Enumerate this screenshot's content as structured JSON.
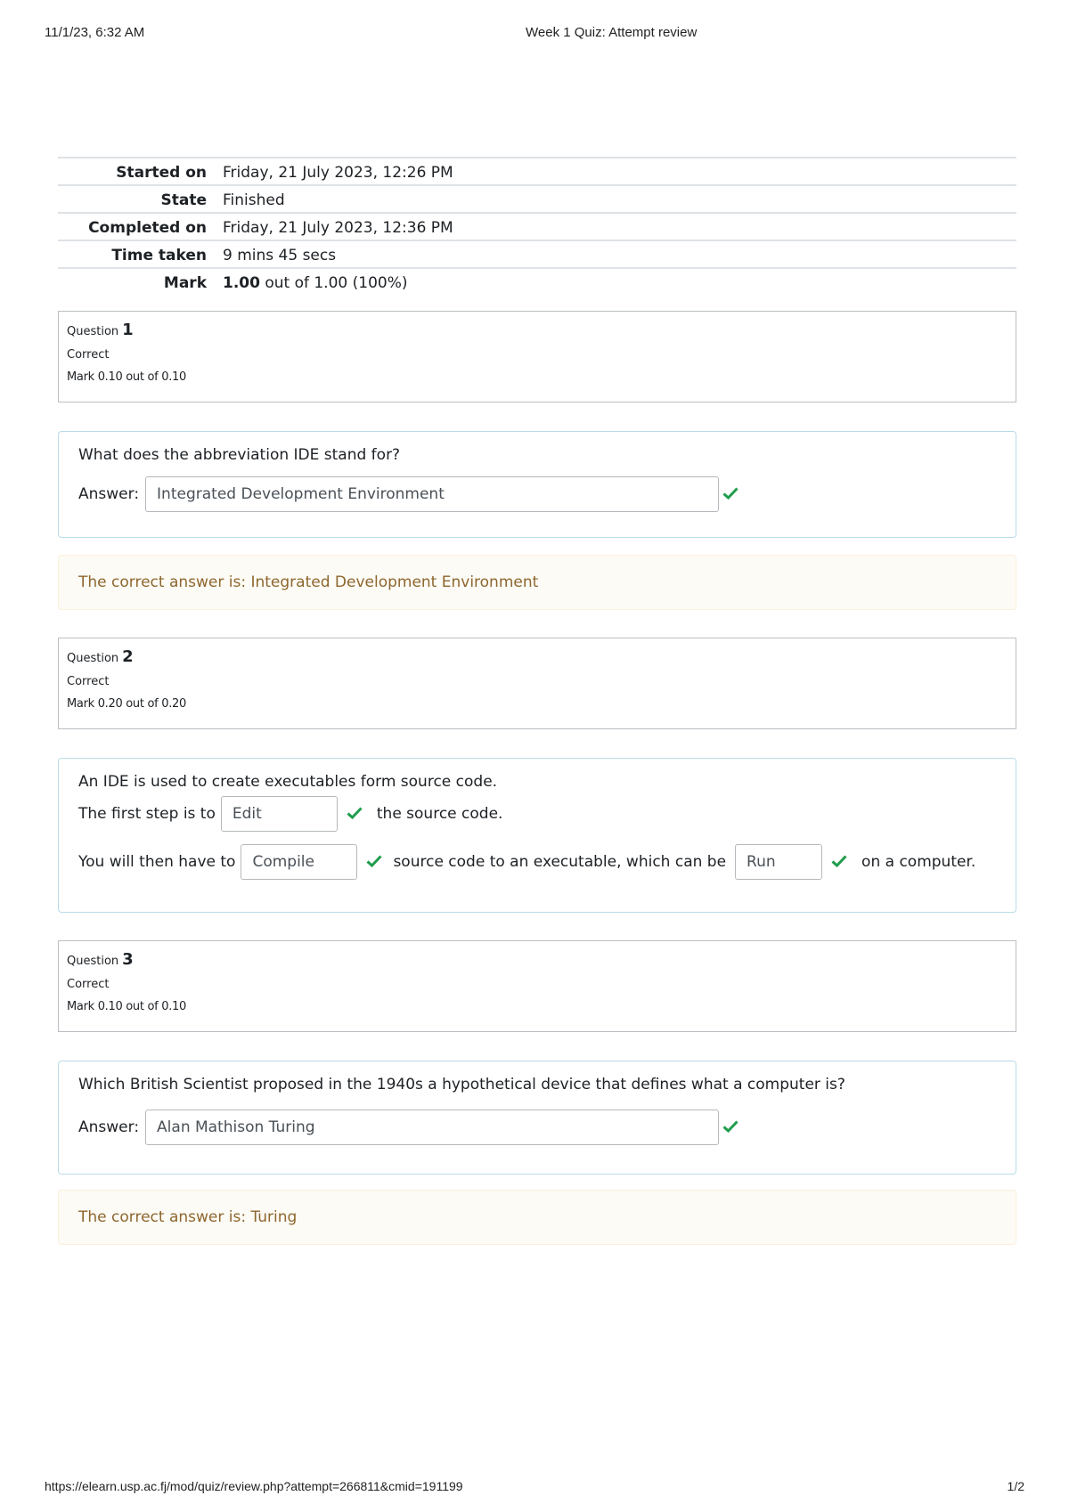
{
  "print_header": {
    "datetime": "11/1/23, 6:32 AM",
    "title": "Week 1 Quiz: Attempt review"
  },
  "summary": [
    {
      "label": "Started on",
      "value": "Friday, 21 July 2023, 12:26 PM"
    },
    {
      "label": "State",
      "value": "Finished"
    },
    {
      "label": "Completed on",
      "value": "Friday, 21 July 2023, 12:36 PM"
    },
    {
      "label": "Time taken",
      "value": "9 mins 45 secs"
    },
    {
      "label": "Mark",
      "value_bold": "1.00",
      "value_rest": " out of 1.00 (100%)"
    }
  ],
  "questions": [
    {
      "label": "Question",
      "number": "1",
      "state": "Correct",
      "grade": "Mark 0.10 out of 0.10",
      "text": "What does the abbreviation IDE stand for?",
      "answer_label": "Answer:",
      "answer_value": "Integrated Development Environment",
      "feedback": "The correct answer is: Integrated Development Environment"
    },
    {
      "label": "Question",
      "number": "2",
      "state": "Correct",
      "grade": "Mark 0.20 out of 0.20",
      "text": "An IDE is used to create executables form source code.",
      "line1": {
        "before": "The first step is to",
        "answer": "Edit",
        "after": "the source code."
      },
      "line2": {
        "before": "You will then have to",
        "answer1": "Compile",
        "middle": "source code to an executable, which can be",
        "answer2": "Run",
        "after": "on a computer."
      }
    },
    {
      "label": "Question",
      "number": "3",
      "state": "Correct",
      "grade": "Mark 0.10 out of 0.10",
      "text": "Which British Scientist proposed in the 1940s a hypothetical device that defines what a computer is?",
      "answer_label": "Answer:",
      "answer_value": "Alan Mathison Turing",
      "feedback": "The correct answer is: Turing"
    }
  ],
  "print_footer": {
    "url": "https://elearn.usp.ac.fj/mod/quiz/review.php?attempt=266811&cmid=191199",
    "page": "1/2"
  },
  "colors": {
    "correct_check": "#1f9d4c",
    "feedback_text": "#8e662e",
    "formulation_border": "#b8dce8"
  }
}
